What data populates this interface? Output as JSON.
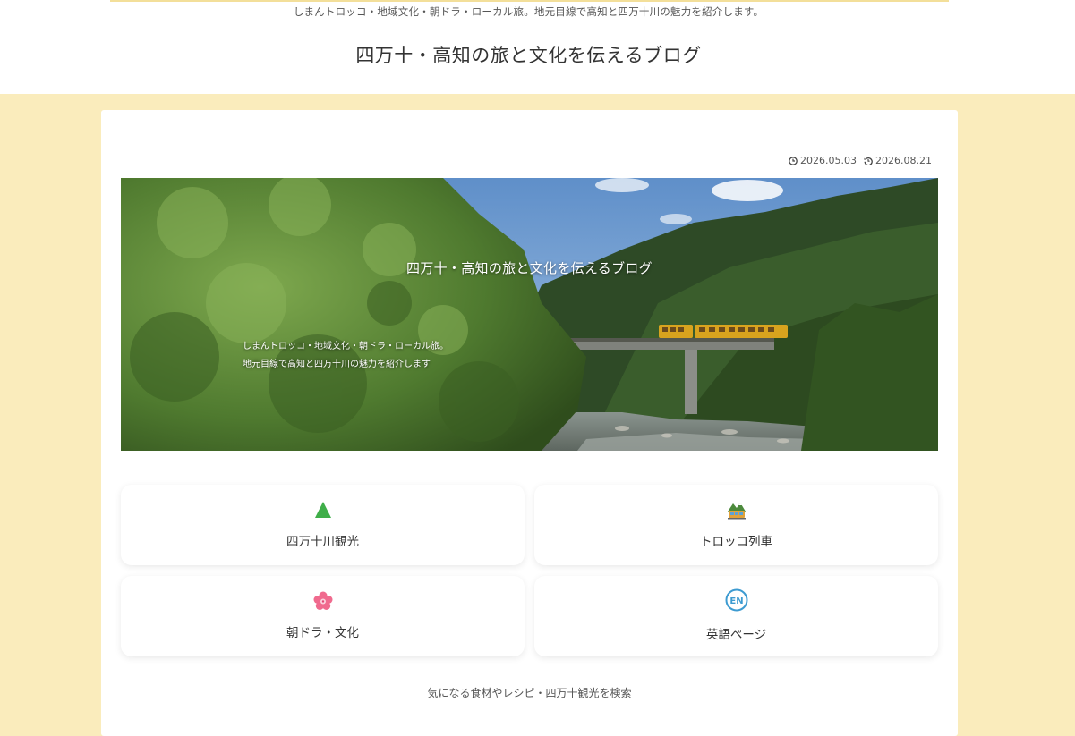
{
  "header": {
    "tagline": "しまんトロッコ・地域文化・朝ドラ・ローカル旅。地元目線で高知と四万十川の魅力を紹介します。",
    "site_title": "四万十・高知の旅と文化を伝えるブログ"
  },
  "post": {
    "published_date": "2026.05.03",
    "updated_date": "2026.08.21",
    "published_icon": "clock-icon",
    "updated_icon": "history-icon"
  },
  "hero": {
    "title": "四万十・高知の旅と文化を伝えるブログ",
    "subtitle_line1": "しまんトロッコ・地域文化・朝ドラ・ローカル旅。",
    "subtitle_line2": "地元目線で高知と四万十川の魅力を紹介します"
  },
  "categories": [
    {
      "label": "四万十川観光",
      "icon": "mountain-icon"
    },
    {
      "label": "トロッコ列車",
      "icon": "mountain-railway-icon"
    },
    {
      "label": "朝ドラ・文化",
      "icon": "cherry-blossom-icon"
    },
    {
      "label": "英語ページ",
      "icon": "en-circle-icon"
    }
  ],
  "search": {
    "hint": "気になる食材やレシピ・四万十観光を検索"
  },
  "colors": {
    "page_background": "#faecbc",
    "accent_line": "#f3df9a"
  }
}
